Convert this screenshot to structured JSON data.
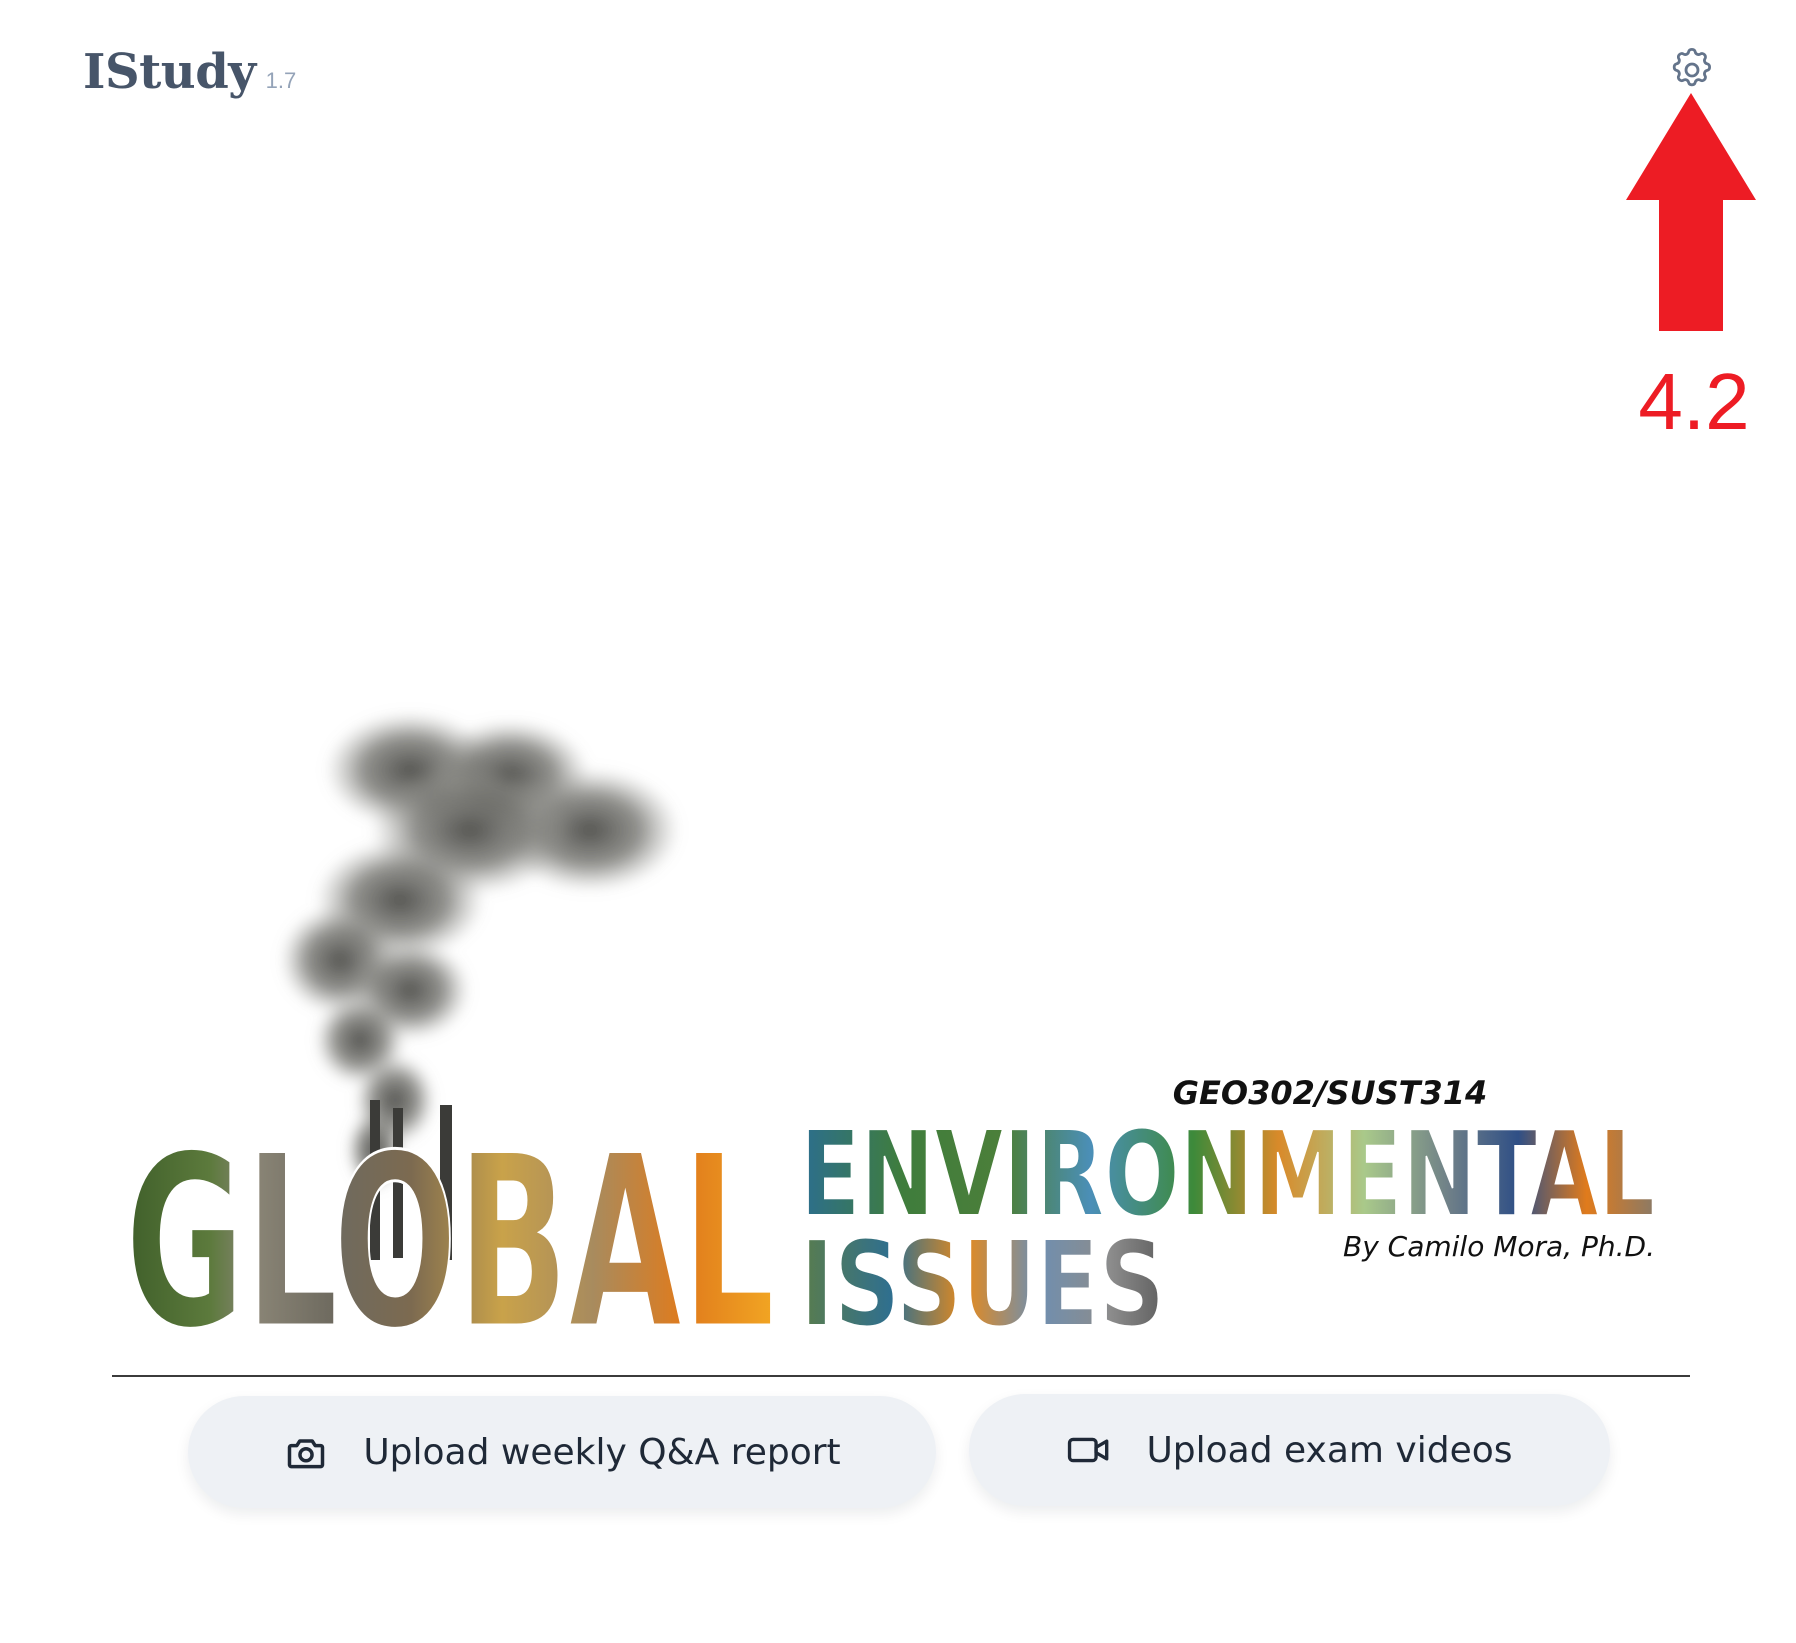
{
  "header": {
    "app_name": "IStudy",
    "version": "1.7",
    "settings_icon": "gear-icon"
  },
  "annotation": {
    "label": "4.2",
    "color": "#ed1c24"
  },
  "banner": {
    "course_code": "GEO302/SUST314",
    "title_line1_left": "GLOBAL",
    "title_line1_right": "ENVIRONMENTAL",
    "title_line2": "ISSUES",
    "author": "By Camilo Mora, Ph.D."
  },
  "actions": {
    "upload_report": {
      "label": "Upload weekly Q&A report",
      "icon": "camera-icon"
    },
    "upload_video": {
      "label": "Upload exam videos",
      "icon": "video-camera-icon"
    }
  }
}
